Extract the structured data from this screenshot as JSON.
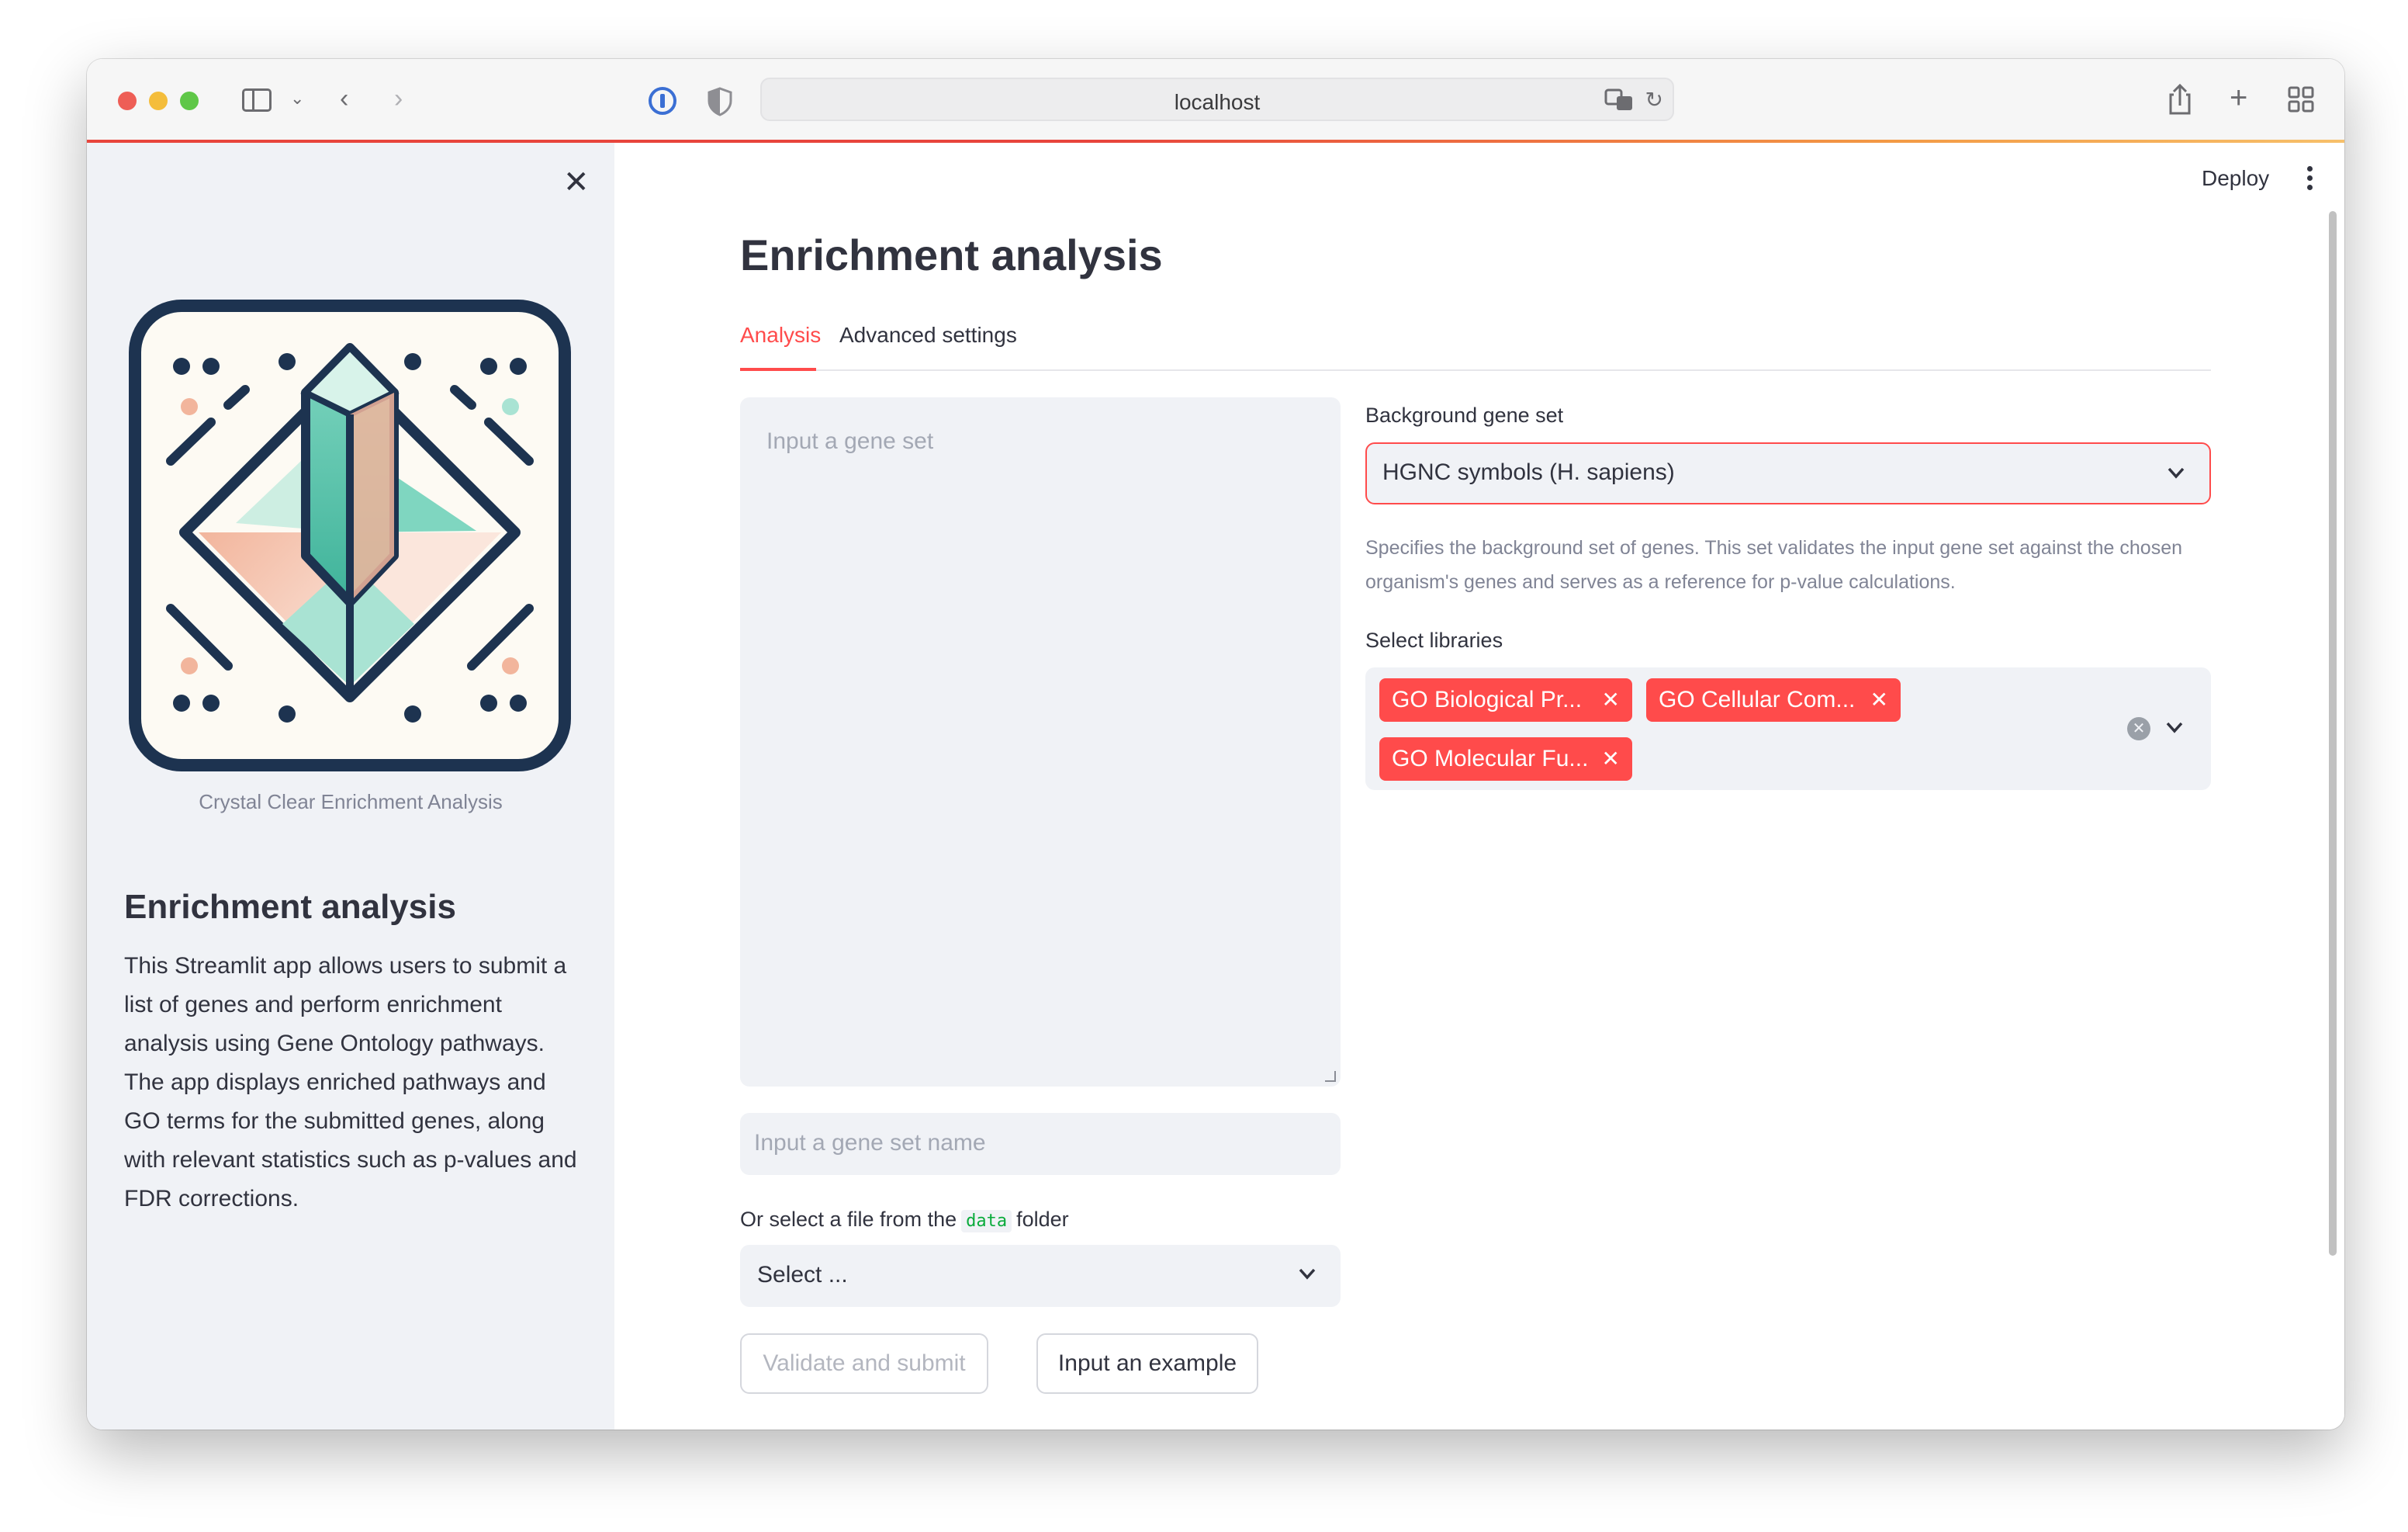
{
  "browser": {
    "address": "localhost"
  },
  "sidebar": {
    "logo_caption": "Crystal Clear Enrichment Analysis",
    "title": "Enrichment analysis",
    "description": "This Streamlit app allows users to submit a list of genes and perform enrichment analysis using Gene Ontology pathways. The app displays enriched pathways and GO terms for the submitted genes, along with relevant statistics such as p-values and FDR corrections."
  },
  "header": {
    "deploy_label": "Deploy"
  },
  "main": {
    "title": "Enrichment analysis",
    "tabs": [
      {
        "label": "Analysis",
        "active": true
      },
      {
        "label": "Advanced settings",
        "active": false
      }
    ],
    "gene_set_placeholder": "Input a gene set",
    "gene_set_name_placeholder": "Input a gene set name",
    "file_select_label_prefix": "Or select a file from the",
    "file_select_label_code": "data",
    "file_select_label_suffix": "folder",
    "file_select_value": "Select ...",
    "validate_button": "Validate and submit",
    "example_button": "Input an example",
    "background": {
      "label": "Background gene set",
      "value": "HGNC symbols (H. sapiens)",
      "help": "Specifies the background set of genes. This set validates the input gene set against the chosen organism's genes and serves as a reference for p-value calculations."
    },
    "libraries": {
      "label": "Select libraries",
      "selected": [
        "GO Biological Pr...",
        "GO Cellular Com...",
        "GO Molecular Fu..."
      ]
    }
  },
  "colors": {
    "accent": "#ff4b4b",
    "sidebar_bg": "#f0f2f6",
    "text": "#31333f",
    "muted": "#808495"
  }
}
